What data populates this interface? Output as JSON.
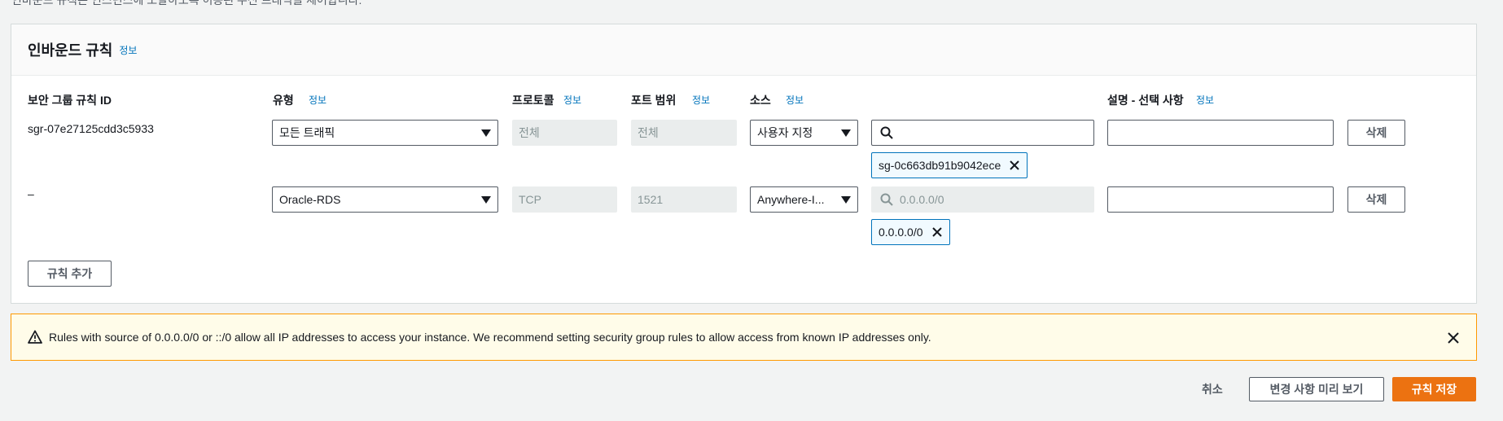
{
  "top_text": "인바운드 규칙은 인스턴스에 도달하도록 허용된 수신 트래픽을 제어합니다.",
  "panel": {
    "title": "인바운드 규칙",
    "info": "정보"
  },
  "columns": {
    "rule_id": "보안 그룹 규칙 ID",
    "type": "유형",
    "protocol": "프로토콜",
    "port_range": "포트 범위",
    "source": "소스",
    "description": "설명 - 선택 사항",
    "info": "정보"
  },
  "rules": [
    {
      "rule_id": "sgr-07e27125cdd3c5933",
      "type": "모든 트래픽",
      "protocol": "전체",
      "port_range": "전체",
      "source": "사용자 지정",
      "search_value": "",
      "search_placeholder": "",
      "token": "sg-0c663db91b9042ece",
      "description": "",
      "delete": "삭제"
    },
    {
      "rule_id": "–",
      "type": "Oracle-RDS",
      "protocol": "TCP",
      "port_range": "1521",
      "source": "Anywhere-I...",
      "search_value": "",
      "search_placeholder": "0.0.0.0/0",
      "token": "0.0.0.0/0",
      "description": "",
      "delete": "삭제"
    }
  ],
  "add_rule": "규칙 추가",
  "alert": {
    "text": "Rules with source of 0.0.0.0/0 or ::/0 allow all IP addresses to access your instance. We recommend setting security group rules to allow access from known IP addresses only."
  },
  "footer": {
    "cancel": "취소",
    "preview": "변경 사항 미리 보기",
    "save": "규칙 저장"
  },
  "colors": {
    "primary": "#ec7211",
    "link": "#0073bb",
    "warning_border": "#ff9900"
  }
}
